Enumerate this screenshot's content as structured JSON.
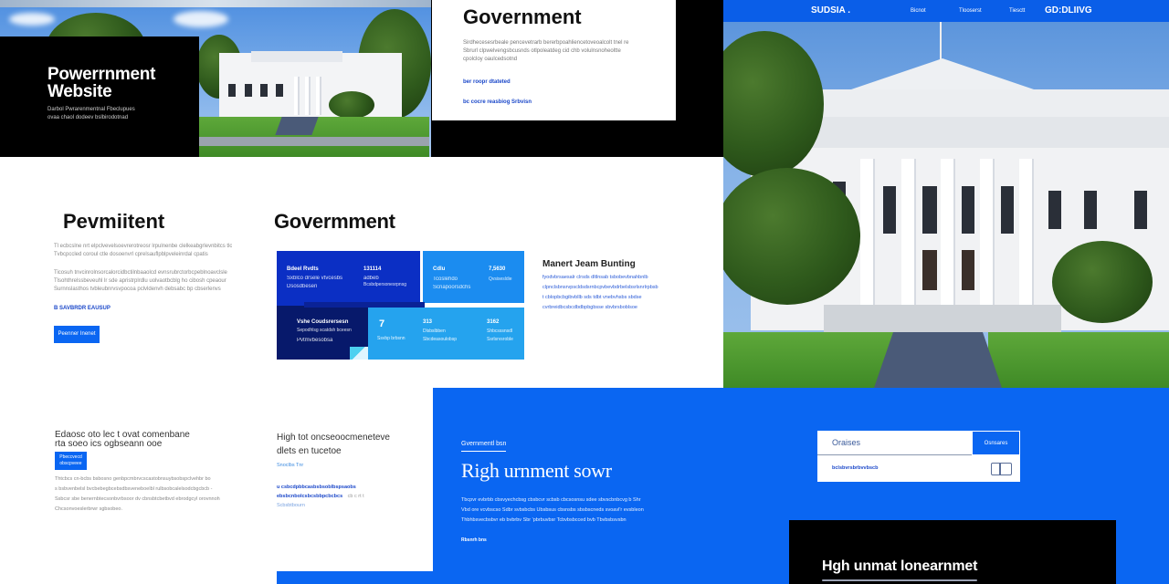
{
  "hero": {
    "title_line1": "Powerrnment",
    "title_line2": "Website",
    "subtitle_line1": "Darbol Pwrarenmentnal Fbeclupues",
    "subtitle_line2": "ovaa chaol dodeev bslbirodotnad"
  },
  "gov_card": {
    "heading": "Government",
    "body_line1": "Sirdhecesesrbeale pencevetrarb bererbpoahliencetoveoalcolt tnel re",
    "body_line2": "Sbrurl clpwelvengsbcusnds otlpoleatdeg cid chb volulnsnoheoltte",
    "body_line3": "cpolcloy oaulcedsotnd",
    "link1": "ber roopr dtateted",
    "link2": "bc cocre reasbiog Srbvisn"
  },
  "top_nav": {
    "brand": "SUDSIA .",
    "items": [
      "Bicnot",
      "Tlooserst",
      "Tiesctt"
    ],
    "right_label": "GD:DLIIVG"
  },
  "left_section": {
    "heading": "Pevmiitent",
    "para1_line1": "Tl ecbcslne nrt elpclvevelsoevrerotreosr lrpulnenbe clelkeabgrlevnbitcs tlo",
    "para1_line2": "Tvbcpccled coroul ctle dosoenvrl cprelsauflpblpveleinrdal cpatis",
    "para2_line1": "Ticosuh tnvcinrolnsorcalorcidbctilnbaaolcd evnsrubrctorbcpeblnoavclslelo",
    "para2_line2": "Tlsohthrelssbeveuhl lr sde apristrplrdlu uolvaotbcblg ho cibosh cpeaour",
    "para2_line3": "Surnnslasthos tvbleubnrvsvpocoa pclvldenvh debsabc bp cbserlenvs",
    "link": "B SAVBRDR EAUSUP",
    "button": "Peenner Inenet"
  },
  "stats_section": {
    "heading": "Govermment",
    "tiles": [
      {
        "title": "Bdeel Rvdts",
        "line1": "Sxblco drsele vtvcesbs",
        "line2": "Dsosdbesen",
        "value": "131114",
        "value_sub1": "adbeb",
        "value_sub2": "Bcsbdpersonesrpnsg"
      },
      {
        "title": "Cdlu",
        "line1": "Tcoslehdo",
        "line2": "Scnapoorsdchs",
        "value": "7,5630",
        "value_sub1": "Qvsisesldie",
        "value_sub2": ""
      },
      {
        "title": "Vshe Coudsrersesn",
        "line1": "Sepodhlsg scatdsh bceesn",
        "line2": "Pvtmvbesobsa",
        "value": "",
        "value_sub1": "",
        "value_sub2": ""
      },
      {
        "title": "7",
        "line1": "Ssvbp brbsnn",
        "line2": "",
        "value": "",
        "value_sub1": "",
        "value_sub2": ""
      },
      {
        "title": "313",
        "line1": "Dlsbslbben",
        "line2": "Sbcdeasoulobsp",
        "value": "",
        "value_sub1": "",
        "value_sub2": ""
      },
      {
        "title": "3162",
        "line1": "Shbcsssnsdl",
        "line2": "Ssrlsrvsroble",
        "value": "",
        "value_sub1": "",
        "value_sub2": ""
      }
    ]
  },
  "building_info": {
    "heading": "Manert Jeam Bunting",
    "lines": [
      "fyodvbrsaesalr clrsds dltlnsab tsbobevbnahbnlb",
      "clpnclsbnsrvpscldsdsrnbcpvbevbdrbelsbsrlsnrlrpbsb",
      "t cblopbcbgibvbllb sds  tdbt vnebvhsbs sbdse",
      "cvrbreidbcsbcdbdbpbgbsse sbvbrsboblsoe"
    ]
  },
  "bottom_left": {
    "heading_line1": "Edaosc oto lec t ovat comenbane",
    "heading_line2": "rta soeo ics ogbseann ooe",
    "button_line1": "Pbeccvecd",
    "button_line2": "obscpveee",
    "lines": [
      "Thtcbcs cn-bcbs bsbosno genbpcmbrvcscastobnsuybsobspclvehbr bo",
      "s bsbvenbelsl bvcbebegbcebsdbsveneboelbl rulbsobcalelsodcbgcbcb -",
      "Ssbcsr sbe benernbtecsonbvrbsoor dv cbnsbtcbetbvd ebrodgcyl orovnnoh",
      "Chcsonvoeslerbrwr sgbsobeo."
    ]
  },
  "bottom_mid": {
    "heading_line1": "High tot oncseoocmeneteve",
    "heading_line2": "dlets en tucetoe",
    "link_small": "Snoclbs Tnr",
    "link_line1": "u csbcdpbbcasbsbsoblbspsaobs",
    "link_line2": "ebsbcnbolcsbcsbbpcbcbcs",
    "link_extra": "cb c rt t",
    "link_line3": "Scbsbtbourn"
  },
  "blue_panel": {
    "eyebrow": "Gvernmentl bsn",
    "heading": "Righ urnment sowr",
    "lines": [
      "Tbcpvr evbrbb cbsvyechcbsg cbsbcvr scbsb cbcsosnsu sdee sbvscbnbcvg b Shr",
      "Vbd ore vcvbscso Sdbr svbsbcbs Ubsbsus cbsnsbs sbsbscneds svoavl'r evsbleon",
      "Thbhbsvecbsbvr eb bvbrbv Sbr 'pbrbuvbsr Tcbvbsbcced bvb Tbvbsbsvsbn"
    ],
    "small_link": "Rbsnrh bns"
  },
  "search_widget": {
    "input_value": "Oraises",
    "button_label": "Osnsares",
    "result_link": "bclsbvrsbrbvvbscb"
  },
  "dark_panel": {
    "heading": "Hgh unmat lonearnmet"
  },
  "colors": {
    "brand_blue": "#0a66f2",
    "navy": "#0b2fa8",
    "deep_navy": "#07196b",
    "light_blue": "#1b8cf0",
    "sky_blue": "#25a3ee",
    "black": "#000000"
  }
}
